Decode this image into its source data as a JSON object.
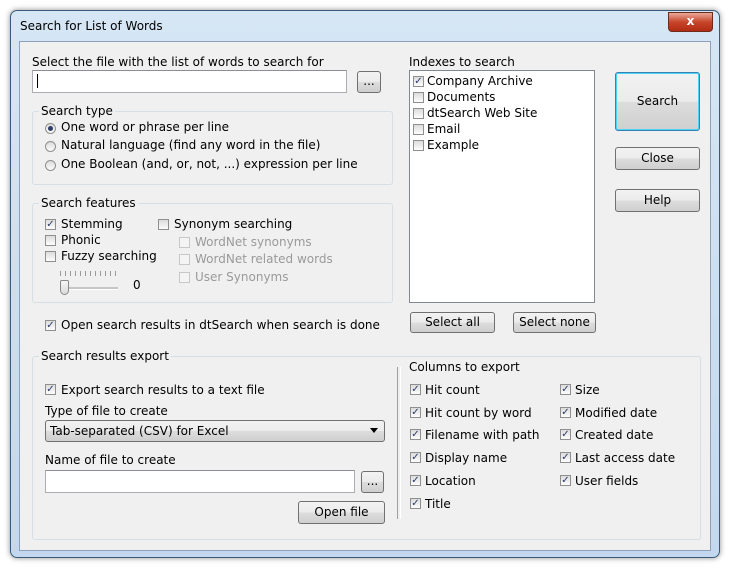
{
  "window": {
    "title": "Search for List of Words",
    "close_glyph": "x"
  },
  "file": {
    "label": "Select the file with the list of words to search for",
    "value": "",
    "browse": "..."
  },
  "search_type": {
    "title": "Search type",
    "options": [
      "One word or phrase per line",
      "Natural language (find any word in the file)",
      "One Boolean (and, or, not, ...) expression per line"
    ],
    "selected": 0
  },
  "features": {
    "title": "Search features",
    "stemming": "Stemming",
    "phonic": "Phonic",
    "fuzzy": "Fuzzy searching",
    "synonym": "Synonym searching",
    "wordnet_syn": "WordNet synonyms",
    "wordnet_rel": "WordNet related words",
    "user_syn": "User Synonyms",
    "fuzzy_value": "0"
  },
  "open_results": "Open search results in dtSearch when search is done",
  "indexes": {
    "label": "Indexes to search",
    "items": [
      "Company Archive",
      "Documents",
      "dtSearch Web Site",
      "Email",
      "Example"
    ],
    "select_all": "Select all",
    "select_none": "Select none"
  },
  "buttons": {
    "search": "Search",
    "close": "Close",
    "help": "Help"
  },
  "export": {
    "title": "Search results export",
    "export_check": "Export search results to a text file",
    "type_label": "Type of file to create",
    "type_value": "Tab-separated (CSV) for Excel",
    "name_label": "Name of file to create",
    "name_value": "",
    "browse": "...",
    "open_file": "Open file"
  },
  "columns": {
    "label": "Columns to export",
    "left": [
      "Hit count",
      "Hit count by word",
      "Filename with path",
      "Display name",
      "Location",
      "Title"
    ],
    "right": [
      "Size",
      "Modified date",
      "Created date",
      "Last access date",
      "User fields"
    ]
  }
}
